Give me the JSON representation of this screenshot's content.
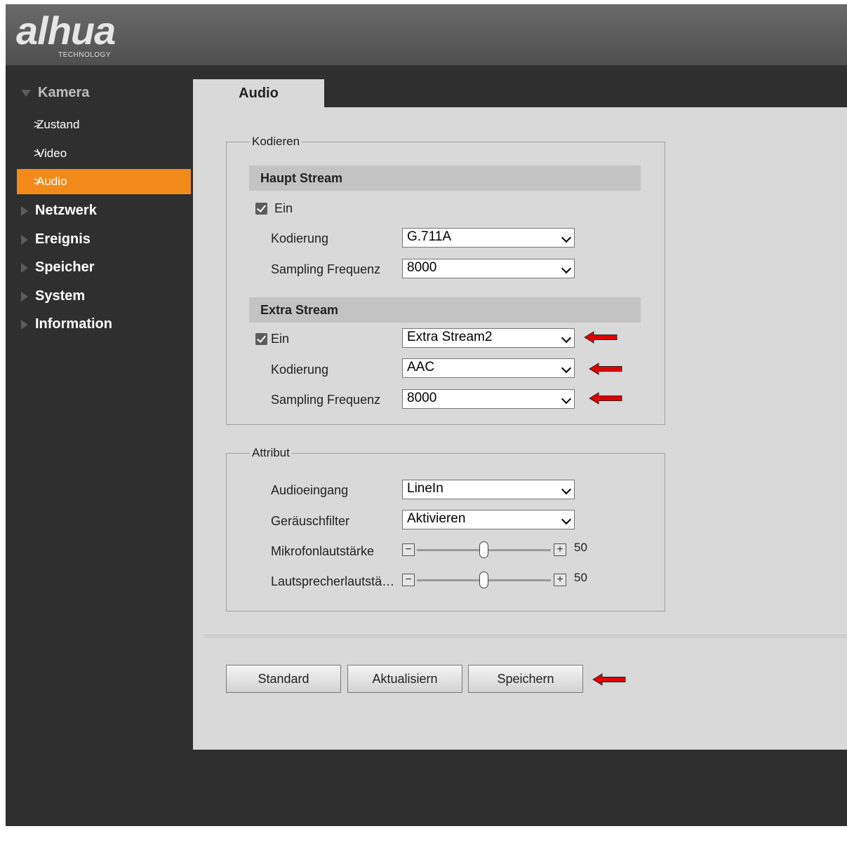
{
  "header": {
    "logo_text": "alhua",
    "logo_subtext": "TECHNOLOGY"
  },
  "sidebar": {
    "groups": [
      {
        "label": "Kamera",
        "expanded": true
      },
      {
        "label": "Netzwerk"
      },
      {
        "label": "Ereignis"
      },
      {
        "label": "Speicher"
      },
      {
        "label": "System"
      },
      {
        "label": "Information"
      }
    ],
    "camera_items": [
      {
        "label": "Zustand"
      },
      {
        "label": "Video"
      },
      {
        "label": "Audio",
        "active": true
      }
    ]
  },
  "tabs": [
    {
      "label": "Audio",
      "active": true
    }
  ],
  "encode": {
    "legend": "Kodieren",
    "main_stream": {
      "title": "Haupt Stream",
      "enable_label": "Ein",
      "enabled": true,
      "codec_label": "Kodierung",
      "codec_value": "G.711A",
      "sampling_label": "Sampling Frequenz",
      "sampling_value": "8000"
    },
    "extra_stream": {
      "title": "Extra Stream",
      "enable_label": "Ein",
      "enabled": true,
      "stream_value": "Extra Stream2",
      "codec_label": "Kodierung",
      "codec_value": "AAC",
      "sampling_label": "Sampling Frequenz",
      "sampling_value": "8000"
    }
  },
  "attribute": {
    "legend": "Attribut",
    "input_label": "Audioeingang",
    "input_value": "LineIn",
    "noise_label": "Geräuschfilter",
    "noise_value": "Aktivieren",
    "mic_label": "Mikrofonlautstärke",
    "mic_value": "50",
    "speaker_label": "Lautsprecherlautstä…",
    "speaker_value": "50",
    "minus_glyph": "−",
    "plus_glyph": "+"
  },
  "buttons": {
    "default_label": "Standard",
    "refresh_label": "Aktualisiern",
    "save_label": "Speichern"
  },
  "colors": {
    "accent": "#f28a1a",
    "annotation_arrow": "#e00000"
  }
}
